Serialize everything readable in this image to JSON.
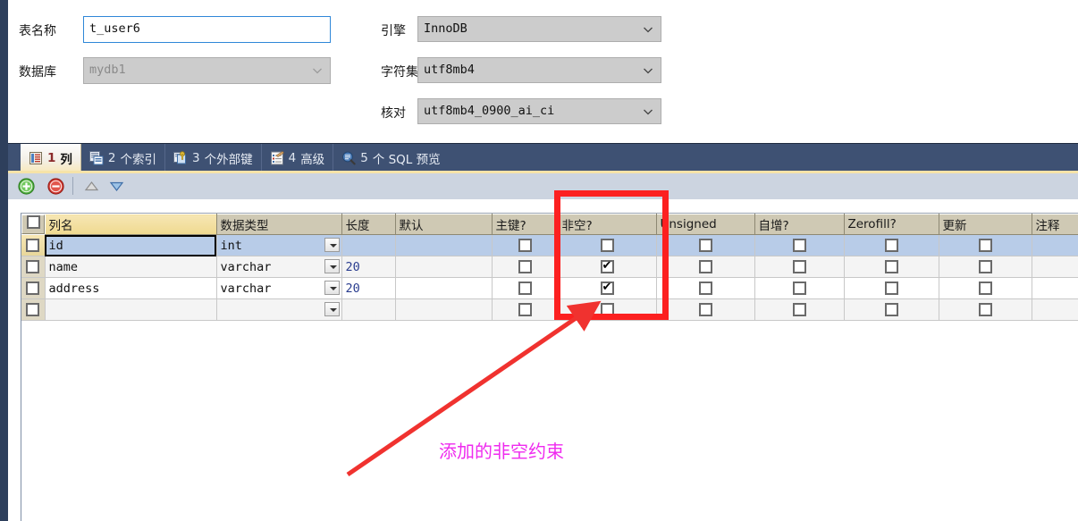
{
  "form": {
    "table_name_label": "表名称",
    "table_name_value": "t_user6",
    "database_label": "数据库",
    "database_value": "mydb1",
    "engine_label": "引擎",
    "engine_value": "InnoDB",
    "charset_label": "字符集",
    "charset_value": "utf8mb4",
    "collation_label": "核对",
    "collation_value": "utf8mb4_0900_ai_ci"
  },
  "tabs": [
    {
      "num": "1",
      "label": "列",
      "icon": "columns-icon",
      "active": true
    },
    {
      "num": "2",
      "label": "个索引",
      "icon": "index-icon",
      "active": false
    },
    {
      "num": "3",
      "label": "个外部键",
      "icon": "foreign-key-icon",
      "active": false
    },
    {
      "num": "4",
      "label": "高级",
      "icon": "advanced-icon",
      "active": false
    },
    {
      "num": "5",
      "label": "个 SQL 预览",
      "icon": "sql-preview-icon",
      "active": false
    }
  ],
  "toolbar": {
    "add": "add-row-icon",
    "remove": "remove-row-icon",
    "move_up": "move-up-icon",
    "move_down": "move-down-icon"
  },
  "grid": {
    "headers": [
      "列名",
      "数据类型",
      "长度",
      "默认",
      "主键?",
      "非空?",
      "Unsigned",
      "自增?",
      "Zerofill?",
      "更新",
      "注释"
    ],
    "rows": [
      {
        "name": "id",
        "type": "int",
        "length": "",
        "default": "",
        "pk": false,
        "notnull": false,
        "unsigned": false,
        "autoinc": false,
        "zerofill": false,
        "update": false,
        "comment": false
      },
      {
        "name": "name",
        "type": "varchar",
        "length": "20",
        "default": "",
        "pk": false,
        "notnull": true,
        "unsigned": false,
        "autoinc": false,
        "zerofill": false,
        "update": false,
        "comment": false
      },
      {
        "name": "address",
        "type": "varchar",
        "length": "20",
        "default": "",
        "pk": false,
        "notnull": true,
        "unsigned": false,
        "autoinc": false,
        "zerofill": false,
        "update": false,
        "comment": false
      },
      {
        "name": "",
        "type": "",
        "length": "",
        "default": "",
        "pk": false,
        "notnull": false,
        "unsigned": false,
        "autoinc": false,
        "zerofill": false,
        "update": false,
        "comment": false
      }
    ]
  },
  "annotation": {
    "text": "添加的非空约束",
    "text_color": "#ef2bef",
    "box_color": "#fc2020",
    "arrow_color": "#f0322f"
  }
}
